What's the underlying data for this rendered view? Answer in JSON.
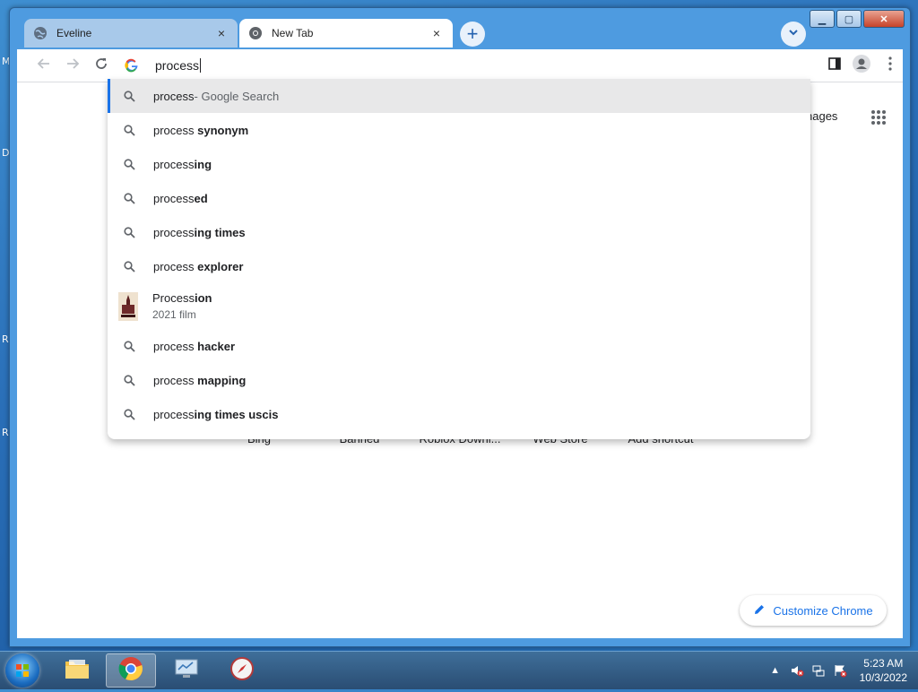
{
  "desktop": {
    "edge_letters": [
      "M",
      "D",
      "R",
      "R"
    ]
  },
  "browser": {
    "tabs": [
      {
        "title": "Eveline",
        "close": "×",
        "active": false
      },
      {
        "title": "New Tab",
        "close": "×",
        "active": true
      }
    ],
    "new_tab": "+",
    "window_controls": {
      "minimize": "▁",
      "maximize": "▢",
      "close": "✕"
    }
  },
  "omnibox": {
    "value": "process"
  },
  "suggestions": [
    {
      "typed": "process",
      "rest": "",
      "suffix": " - Google Search",
      "type": "search",
      "selected": true
    },
    {
      "typed": "process ",
      "rest": "synonym",
      "type": "search"
    },
    {
      "typed": "process",
      "rest": "ing",
      "type": "search"
    },
    {
      "typed": "process",
      "rest": "ed",
      "type": "search"
    },
    {
      "typed": "process",
      "rest": "ing times",
      "type": "search"
    },
    {
      "typed": "process ",
      "rest": "explorer",
      "type": "search"
    },
    {
      "typed": "Process",
      "rest": "ion",
      "subtitle": "2021 film",
      "type": "entity"
    },
    {
      "typed": "process ",
      "rest": "hacker",
      "type": "search"
    },
    {
      "typed": "process ",
      "rest": "mapping",
      "type": "search"
    },
    {
      "typed": "process",
      "rest": "ing times uscis",
      "type": "search"
    }
  ],
  "page": {
    "images_link": "nages",
    "shortcuts": [
      "Bing",
      "Banned",
      "Roblox Downl...",
      "Web Store",
      "Add shortcut"
    ],
    "customize": "Customize Chrome"
  },
  "taskbar": {
    "time": "5:23 AM",
    "date": "10/3/2022"
  },
  "colors": {
    "accent": "#1a73e8",
    "selected_row": "#e8e8e9"
  }
}
